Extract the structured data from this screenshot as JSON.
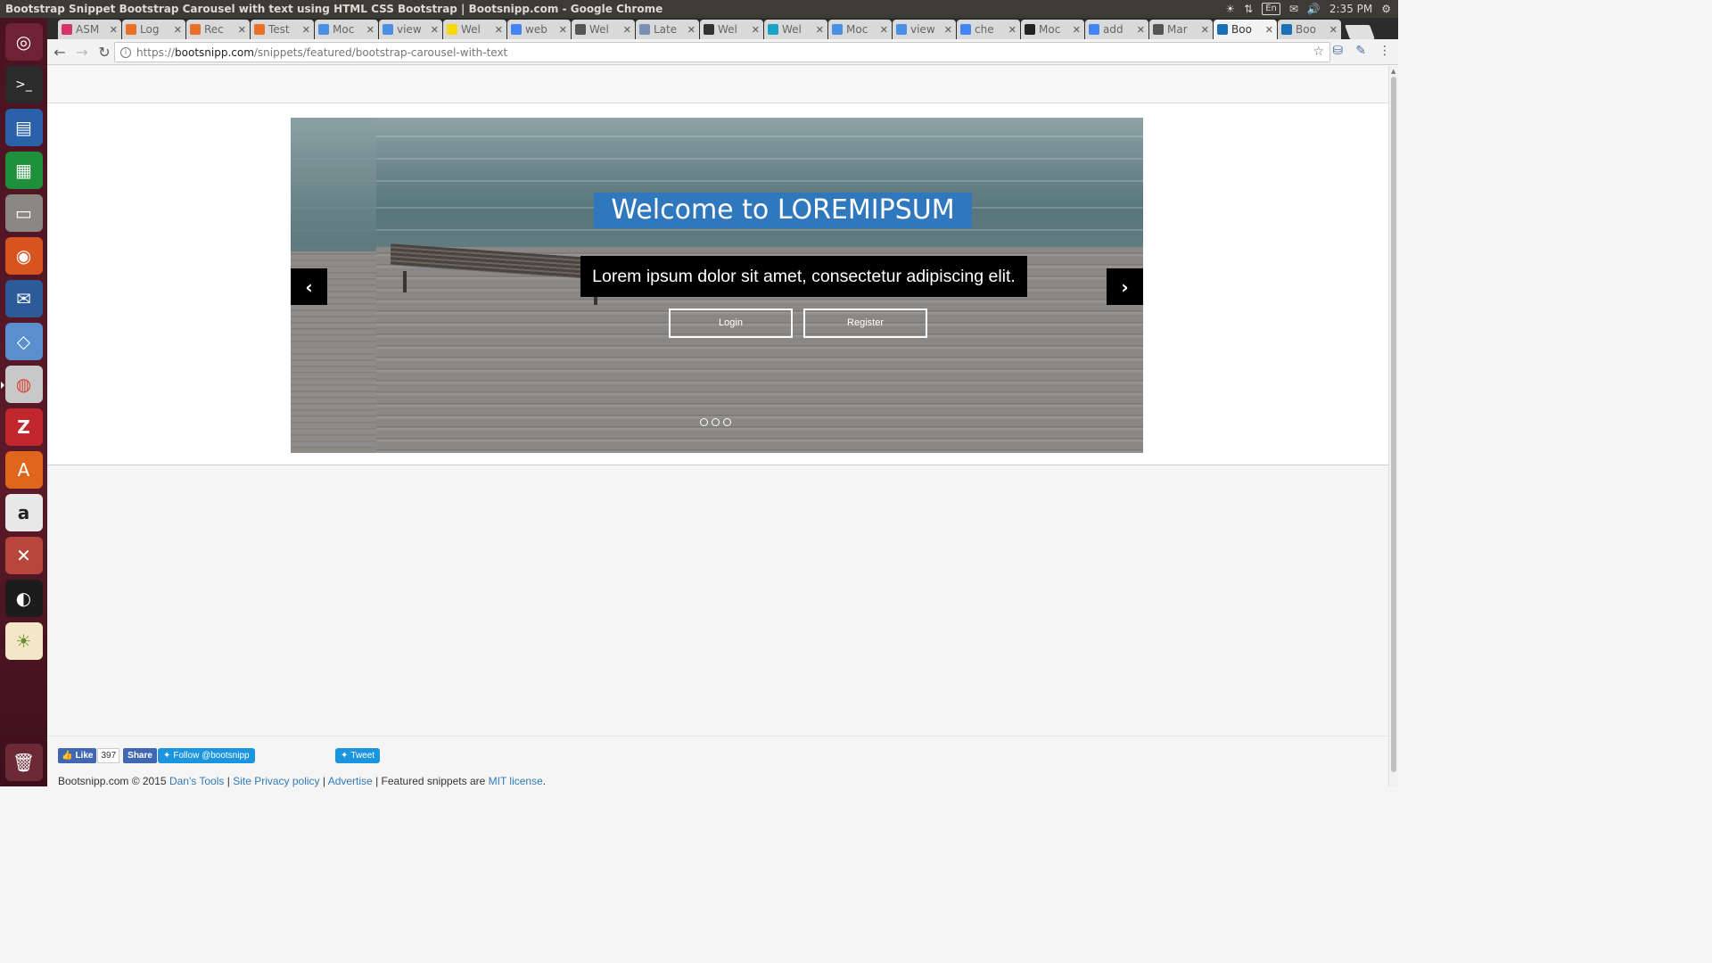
{
  "window": {
    "title": "Bootstrap Snippet Bootstrap Carousel with text using HTML CSS Bootstrap | Bootsnipp.com - Google Chrome",
    "indicators": {
      "keyboard": "En",
      "time": "2:35 PM"
    }
  },
  "launcher": {
    "items": [
      "ubuntu-dash",
      "terminal",
      "libreoffice-writer",
      "libreoffice-calc",
      "files",
      "firefox",
      "thunderbird",
      "virtualbox",
      "chrome",
      "filezilla",
      "software-center",
      "amazon",
      "system-settings",
      "inkscape",
      "brightness-indicator"
    ],
    "trash": "trash"
  },
  "tabs": [
    {
      "label": "ASM",
      "color": "#d6336c"
    },
    {
      "label": "Log",
      "color": "#e8702a"
    },
    {
      "label": "Rec",
      "color": "#e8702a"
    },
    {
      "label": "Test",
      "color": "#e8702a"
    },
    {
      "label": "Moc",
      "color": "#4a90e2"
    },
    {
      "label": "view",
      "color": "#4a90e2"
    },
    {
      "label": "Wel",
      "color": "#f5d90a"
    },
    {
      "label": "web",
      "color": "#4285f4"
    },
    {
      "label": "Wel",
      "color": "#555555"
    },
    {
      "label": "Late",
      "color": "#7b8fb5"
    },
    {
      "label": "Wel",
      "color": "#333333"
    },
    {
      "label": "Wel",
      "color": "#1aa3c8"
    },
    {
      "label": "Moc",
      "color": "#4a90e2"
    },
    {
      "label": "view",
      "color": "#4a90e2"
    },
    {
      "label": "che",
      "color": "#4285f4"
    },
    {
      "label": "Moc",
      "color": "#222222"
    },
    {
      "label": "add",
      "color": "#4285f4"
    },
    {
      "label": "Mar",
      "color": "#555555"
    },
    {
      "label": "Boo",
      "color": "#1a6fb5",
      "active": true
    },
    {
      "label": "Boo",
      "color": "#1a6fb5"
    }
  ],
  "toolbar": {
    "url_scheme": "https://",
    "url_host": "bootsnipp.com",
    "url_path": "/snippets/featured/bootstrap-carousel-with-text"
  },
  "carousel": {
    "title": "Welcome to LOREMIPSUM",
    "text": "Lorem ipsum dolor sit amet, consectetur adipiscing elit.",
    "login_label": "Login",
    "register_label": "Register",
    "prev_icon": "chevron-left-icon",
    "next_icon": "chevron-right-icon",
    "slide_count": 3,
    "title_bg": "#2f78bd",
    "text_bg": "#000000"
  },
  "footer": {
    "like_label": "Like",
    "like_count": "397",
    "share_label": "Share",
    "follow_label": "Follow @bootsnipp",
    "tweet_label": "Tweet",
    "copyright": "Bootsnipp.com © 2015",
    "link_dans_tools": "Dan's Tools",
    "link_privacy": "Site Privacy policy",
    "link_advertise": "Advertise",
    "featured_text": "Featured snippets are",
    "link_license": "MIT license",
    "separator": "|"
  }
}
